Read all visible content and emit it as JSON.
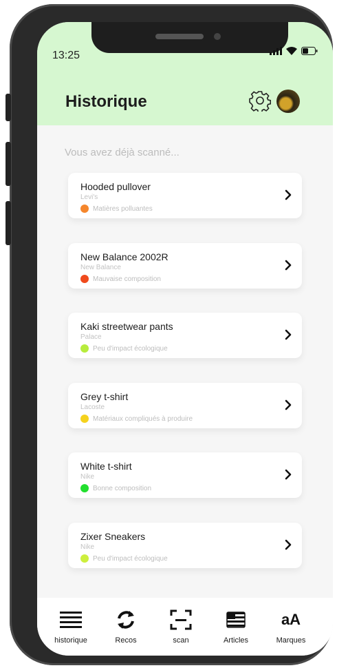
{
  "status_bar": {
    "time": "13:25"
  },
  "header": {
    "title": "Historique"
  },
  "history": {
    "subtitle": "Vous avez déjà scanné...",
    "items": [
      {
        "name": "Hooded pullover",
        "brand": "Levi's",
        "status": "Matières polluantes",
        "status_color": "#f5862c"
      },
      {
        "name": "New Balance 2002R",
        "brand": "New Balance",
        "status": "Mauvaise composition",
        "status_color": "#f04a1d"
      },
      {
        "name": "Kaki streetwear pants",
        "brand": "Palace",
        "status": "Peu d'impact écologique",
        "status_color": "#b7ec3d"
      },
      {
        "name": "Grey t-shirt",
        "brand": "Lacoste",
        "status": "Matériaux compliqués à produire",
        "status_color": "#f5d21e"
      },
      {
        "name": "White t-shirt",
        "brand": "Nike",
        "status": "Bonne composition",
        "status_color": "#22df2e"
      },
      {
        "name": "Zixer Sneakers",
        "brand": "Nike",
        "status": "Peu d'impact écologique",
        "status_color": "#cdef3d"
      }
    ]
  },
  "tabbar": {
    "items": [
      {
        "label": "historique",
        "icon": "list-icon"
      },
      {
        "label": "Recos",
        "icon": "refresh-icon"
      },
      {
        "label": "scan",
        "icon": "scan-icon"
      },
      {
        "label": "Articles",
        "icon": "flag-icon"
      },
      {
        "label": "Marques",
        "icon": "text-aa-icon",
        "icon_text": "aA"
      }
    ]
  },
  "colors": {
    "header_bg": "#d6f7d0",
    "page_bg": "#f6f6f6"
  }
}
